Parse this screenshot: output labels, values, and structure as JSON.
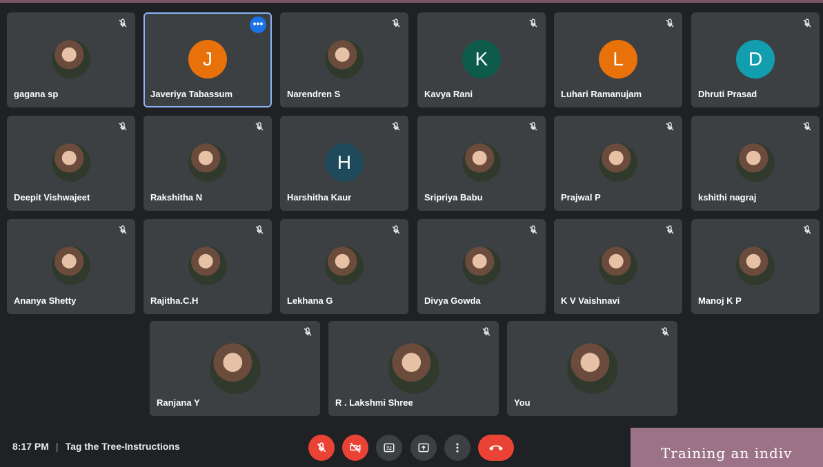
{
  "participants": [
    {
      "name": "gagana sp",
      "avatar": "photo"
    },
    {
      "name": "Javeriya Tabassum",
      "initial": "J",
      "color": "#e8710a",
      "active": true
    },
    {
      "name": "Narendren S",
      "avatar": "photo"
    },
    {
      "name": "Kavya Rani",
      "initial": "K",
      "color": "#0d5b4b"
    },
    {
      "name": "Luhari Ramanujam",
      "initial": "L",
      "color": "#e8710a"
    },
    {
      "name": "Dhruti Prasad",
      "initial": "D",
      "color": "#129eaf"
    },
    {
      "name": "Deepit Vishwajeet",
      "avatar": "photo"
    },
    {
      "name": "Rakshitha N",
      "avatar": "photo"
    },
    {
      "name": "Harshitha Kaur",
      "initial": "H",
      "color": "#1f4a5c"
    },
    {
      "name": "Sripriya Babu",
      "avatar": "photo"
    },
    {
      "name": "Prajwal P",
      "avatar": "photo"
    },
    {
      "name": "kshithi nagraj",
      "avatar": "photo"
    },
    {
      "name": "Ananya Shetty",
      "avatar": "photo"
    },
    {
      "name": "Rajitha.C.H",
      "avatar": "photo"
    },
    {
      "name": "Lekhana G",
      "avatar": "photo"
    },
    {
      "name": "Divya Gowda",
      "avatar": "photo"
    },
    {
      "name": "K V Vaishnavi",
      "avatar": "photo"
    },
    {
      "name": "Manoj K P",
      "avatar": "photo"
    },
    {
      "name": "Ranjana Y",
      "avatar": "photo"
    },
    {
      "name": "R . Lakshmi Shree",
      "avatar": "photo"
    },
    {
      "name": "You",
      "avatar": "photo"
    }
  ],
  "bottom_bar": {
    "time": "8:17 PM",
    "separator": "|",
    "meeting_title": "Tag the Tree-Instructions"
  },
  "controls": [
    "mic-off-icon",
    "camera-off-icon",
    "captions-icon",
    "present-icon",
    "more-options-icon",
    "end-call-icon"
  ],
  "caption_text": "Training an indiv",
  "colors": {
    "tile": "#3c4043",
    "background": "#202124",
    "accent": "#1a73e8",
    "danger": "#ea4335"
  }
}
